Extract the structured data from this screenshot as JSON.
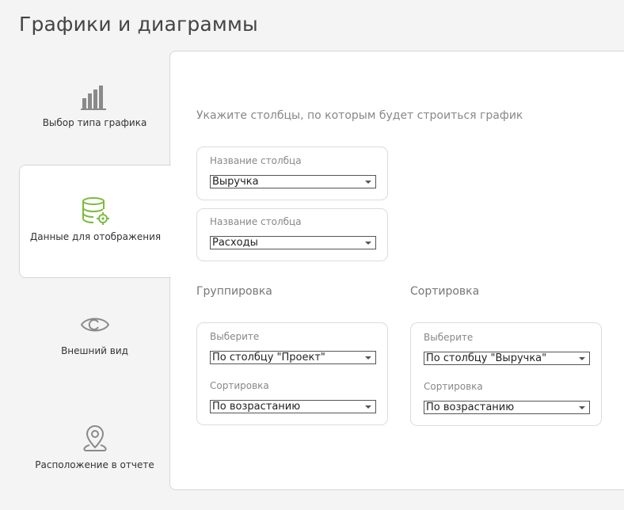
{
  "page": {
    "title": "Графики и диаграммы"
  },
  "steps": [
    {
      "label": "Выбор типа графика",
      "icon": "bar-chart-icon",
      "active": false
    },
    {
      "label": "Данные для отображения",
      "icon": "database-settings-icon",
      "active": true
    },
    {
      "label": "Внешний вид",
      "icon": "eye-icon",
      "active": false
    },
    {
      "label": "Расположение в отчете",
      "icon": "location-pin-icon",
      "active": false
    }
  ],
  "main": {
    "hint": "Укажите столбцы, по которым будет строиться график",
    "columns": [
      {
        "label": "Название столбца",
        "value": "Выручка"
      },
      {
        "label": "Название столбца",
        "value": "Расходы"
      }
    ],
    "grouping": {
      "title": "Группировка",
      "select_label": "Выберите",
      "select_value": "По столбцу \"Проект\"",
      "order_label": "Сортировка",
      "order_value": "По возрастанию"
    },
    "sorting": {
      "title": "Сортировка",
      "select_label": "Выберите",
      "select_value": "По столбцу \"Выручка\"",
      "order_label": "Сортировка",
      "order_value": "По возрастанию"
    }
  },
  "colors": {
    "accent": "#7cbb3f",
    "icon_gray": "#888888"
  }
}
